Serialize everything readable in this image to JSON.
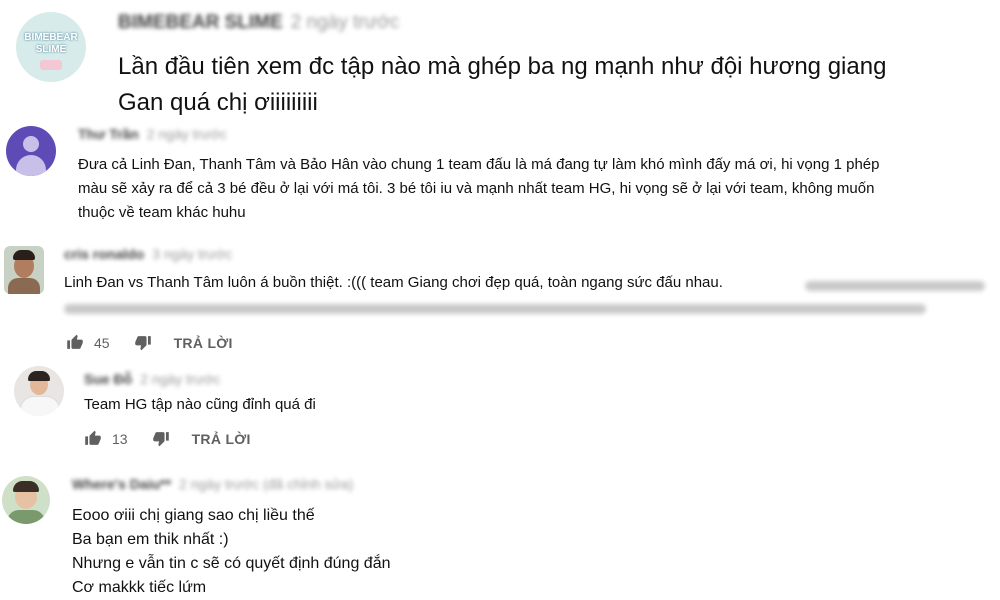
{
  "comments": [
    {
      "author": "BIMEBEAR SLIME",
      "time": "2 ngày trước",
      "avatar_text": [
        "BIMEBEAR",
        "SLIME"
      ],
      "text_lines": [
        "Lần đầu tiên xem đc tập nào mà ghép ba ng mạnh như đội hương giang",
        "Gan quá chị ơiiiiiiiii"
      ]
    },
    {
      "author": "Thư Trần",
      "time": "2 ngày trước",
      "text_lines": [
        "Đưa cả Linh Đan, Thanh Tâm và Bảo Hân vào chung 1 team đấu là má đang tự làm khó mình đấy má ơi, hi vọng 1 phép",
        "màu sẽ xảy ra để cả 3 bé đều ở lại với má tôi. 3 bé tôi iu và mạnh nhất team HG, hi vọng sẽ ở lại với team, không muốn",
        "thuộc về team khác huhu"
      ]
    },
    {
      "author": "cris ronaldo",
      "time": "3 ngày trước",
      "text": "Linh Đan vs Thanh Tâm luôn á buồn thiệt. :((( team Giang chơi đẹp quá, toàn ngang sức đấu nhau.",
      "likes": "45",
      "reply": "TRẢ LỜI"
    },
    {
      "author": "Sue Đỗ",
      "time": "2 ngày trước",
      "text": "Team HG tập nào cũng đỉnh quá đi",
      "likes": "13",
      "reply": "TRẢ LỜI"
    },
    {
      "author": "Where's Daiu**",
      "time": "2 ngày trước (đã chỉnh sửa)",
      "text_lines": [
        "Eooo ơiii chị giang sao chị liều thế",
        "Ba bạn em thik nhất :)",
        "Nhưng e vẫn tin c sẽ có quyết định đúng đắn",
        "Cơ makkk tiếc lứm"
      ]
    }
  ],
  "colors": {
    "accent_purple": "#5f4bb6",
    "text_muted": "#606060",
    "avatar1_bg": "#d7ecea"
  }
}
